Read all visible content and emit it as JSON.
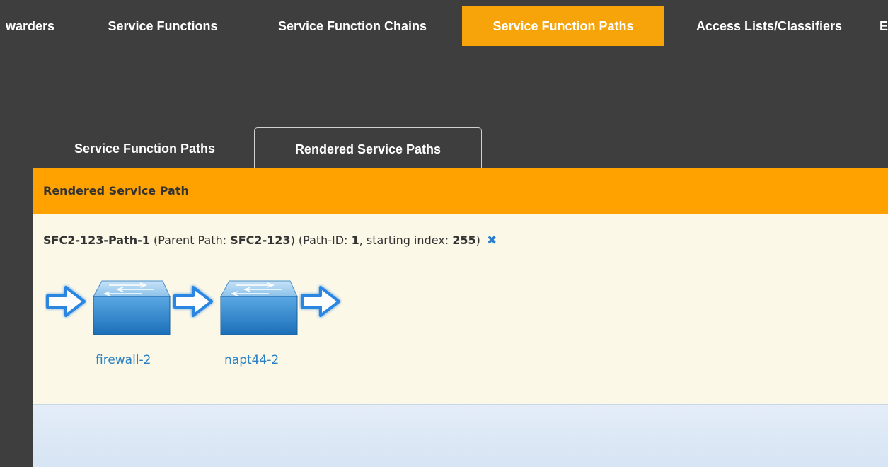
{
  "topnav": {
    "items": [
      {
        "label": "warders"
      },
      {
        "label": "Service Functions"
      },
      {
        "label": "Service Function Chains"
      },
      {
        "label": "Service Function Paths",
        "active": true
      },
      {
        "label": "Access Lists/Classifiers"
      },
      {
        "label": "E"
      }
    ]
  },
  "tabs": [
    {
      "label": "Service Function Paths"
    },
    {
      "label": "Rendered Service Paths",
      "active": true
    }
  ],
  "panel": {
    "title": "Rendered Service Path",
    "path": {
      "name": "SFC2-123-Path-1",
      "parent_prefix": " (Parent Path: ",
      "parent": "SFC2-123",
      "mid": ") (Path-ID: ",
      "path_id": "1",
      "index_prefix": ", starting index: ",
      "starting_index": "255",
      "suffix": ")",
      "delete_icon": "✖"
    },
    "service_functions": [
      {
        "name": "firewall-2",
        "icon": "switch-icon"
      },
      {
        "name": "napt44-2",
        "icon": "switch-icon"
      }
    ]
  },
  "colors": {
    "accent": "#ffa200",
    "nav_active": "#f7a30a",
    "background": "#3e3e3f",
    "panel": "#fcf8e8",
    "link": "#2a81c4"
  }
}
